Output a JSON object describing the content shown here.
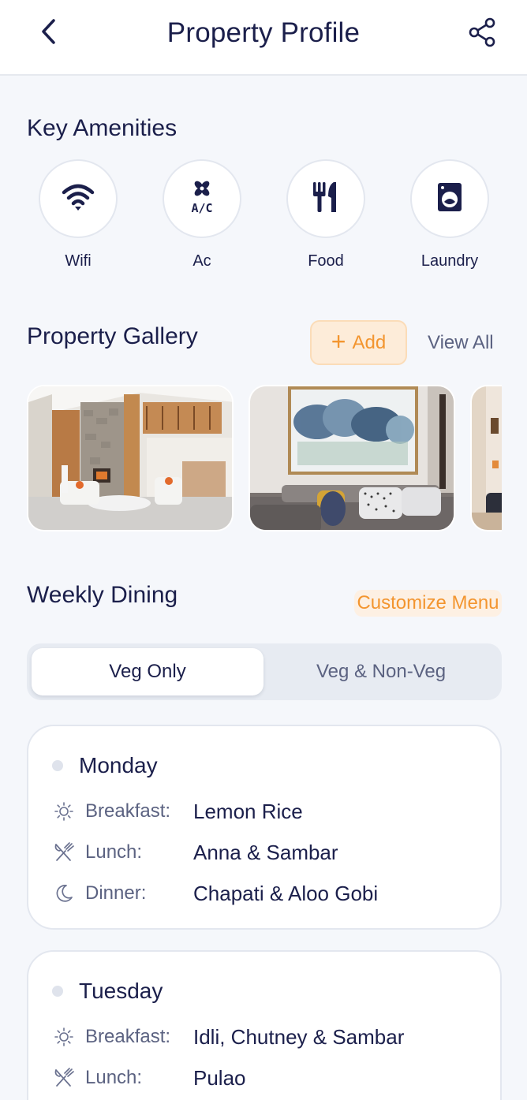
{
  "header": {
    "title": "Property Profile",
    "back_icon": "chevron-left-icon",
    "share_icon": "share-icon"
  },
  "amenities": {
    "title": "Key Amenities",
    "items": [
      {
        "label": "Wifi",
        "icon": "wifi-icon"
      },
      {
        "label": "Ac",
        "icon": "ac-icon",
        "icon_text": "A/C"
      },
      {
        "label": "Food",
        "icon": "utensils-icon"
      },
      {
        "label": "Laundry",
        "icon": "washing-machine-icon"
      }
    ]
  },
  "gallery": {
    "title": "Property Gallery",
    "add_label": "Add",
    "view_all_label": "View All",
    "images": [
      {
        "name": "living-room-photo"
      },
      {
        "name": "lounge-sofa-photo"
      },
      {
        "name": "hallway-photo"
      }
    ]
  },
  "dining": {
    "title": "Weekly Dining",
    "customize_label": "Customize Menu",
    "toggle": {
      "options": [
        "Veg Only",
        "Veg & Non-Veg"
      ],
      "selected": "Veg Only"
    },
    "days": [
      {
        "day": "Monday",
        "meals": [
          {
            "label": "Breakfast:",
            "value": "Lemon Rice",
            "icon": "sun-icon"
          },
          {
            "label": "Lunch:",
            "value": "Anna & Sambar",
            "icon": "fork-knife-icon"
          },
          {
            "label": "Dinner:",
            "value": "Chapati & Aloo Gobi",
            "icon": "moon-icon"
          }
        ]
      },
      {
        "day": "Tuesday",
        "meals": [
          {
            "label": "Breakfast:",
            "value": "Idli, Chutney & Sambar",
            "icon": "sun-icon"
          },
          {
            "label": "Lunch:",
            "value": "Pulao",
            "icon": "fork-knife-icon"
          }
        ]
      }
    ]
  },
  "colors": {
    "primary_text": "#1b1f4b",
    "muted_text": "#5b6281",
    "accent_orange": "#f3952f",
    "background": "#f5f7fb"
  }
}
